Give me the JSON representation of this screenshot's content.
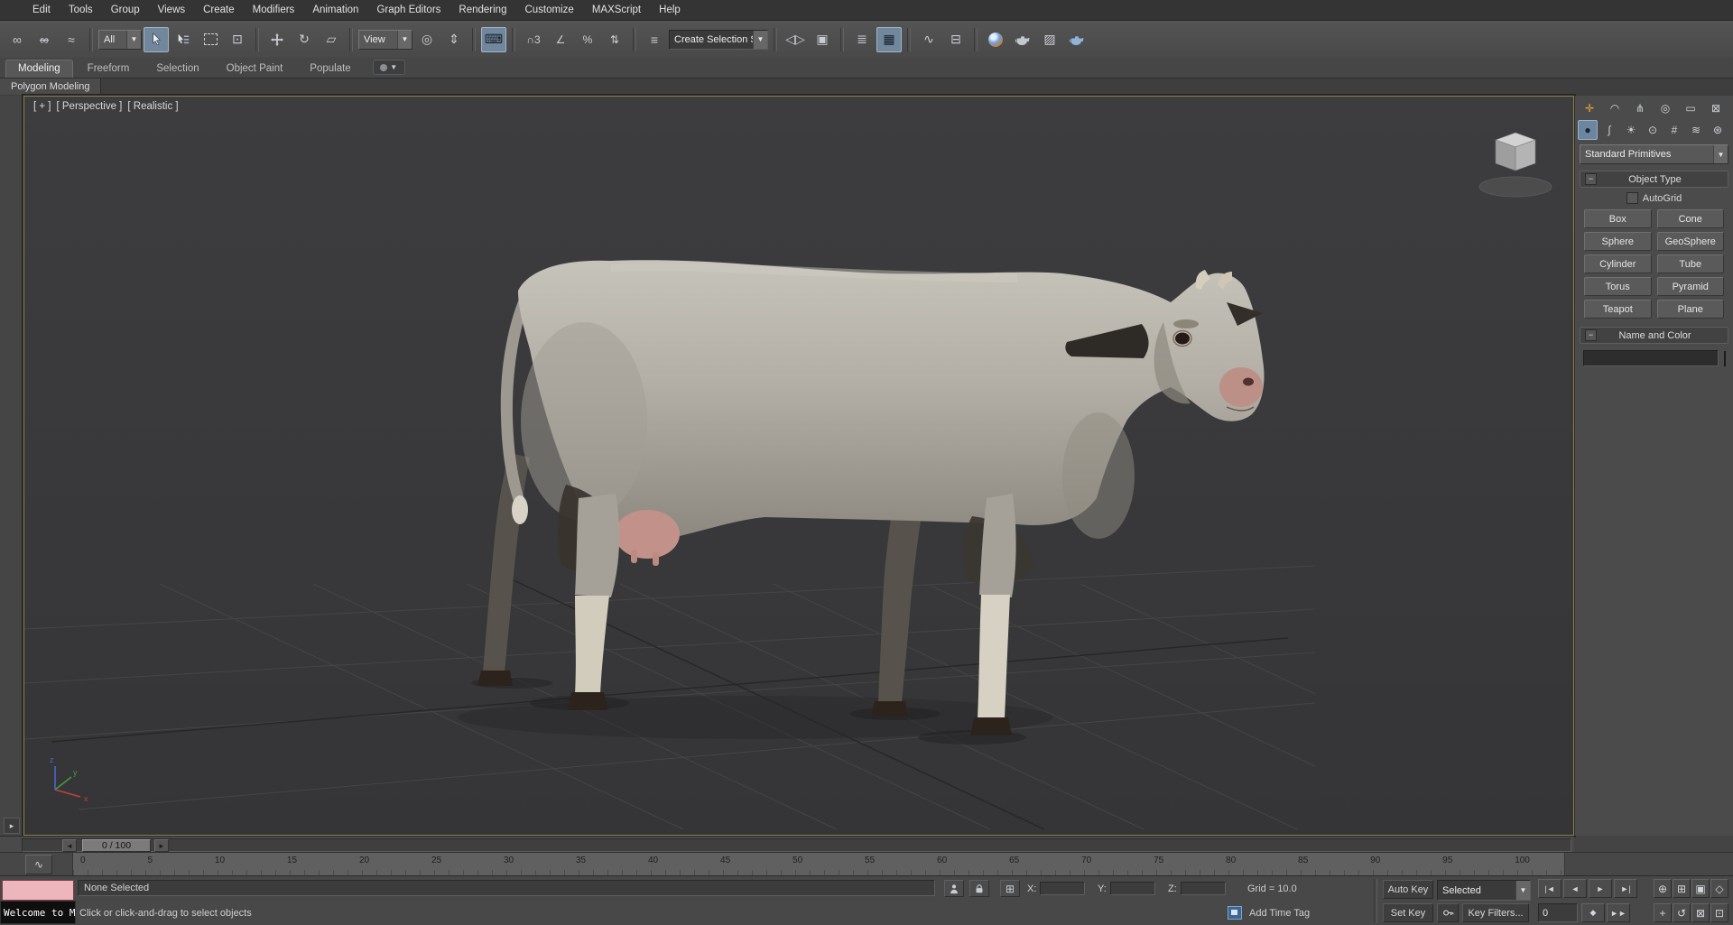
{
  "menu": {
    "items": [
      "Edit",
      "Tools",
      "Group",
      "Views",
      "Create",
      "Modifiers",
      "Animation",
      "Graph Editors",
      "Rendering",
      "Customize",
      "MAXScript",
      "Help"
    ]
  },
  "toolbar": {
    "selection_filter": "All",
    "ref_coord": "View",
    "selection_set": "Create Selection Se",
    "arrow": "▼"
  },
  "ribbon": {
    "tabs": [
      "Modeling",
      "Freeform",
      "Selection",
      "Object Paint",
      "Populate"
    ],
    "panel_tab": "Polygon Modeling"
  },
  "viewport": {
    "label_plus": "[ + ]",
    "label_view": "[ Perspective ]",
    "label_shading": "[ Realistic ]",
    "axis_x": "x",
    "axis_y": "y",
    "axis_z": "z"
  },
  "command_panel": {
    "category_dropdown": "Standard Primitives",
    "object_type": {
      "title": "Object Type",
      "autogrid_label": "AutoGrid",
      "buttons": [
        "Box",
        "Cone",
        "Sphere",
        "GeoSphere",
        "Cylinder",
        "Tube",
        "Torus",
        "Pyramid",
        "Teapot",
        "Plane"
      ]
    },
    "name_color": {
      "title": "Name and Color",
      "name_value": "",
      "swatch_color": "#e93fbe"
    }
  },
  "timeline": {
    "slider_label": "0 / 100",
    "ticks": [
      "0",
      "5",
      "10",
      "15",
      "20",
      "25",
      "30",
      "35",
      "40",
      "45",
      "50",
      "55",
      "60",
      "65",
      "70",
      "75",
      "80",
      "85",
      "90",
      "95",
      "100"
    ]
  },
  "status": {
    "selection_status": "None Selected",
    "prompt": "Click or click-and-drag to select objects",
    "listener_text": "Welcome to M",
    "x_label": "X:",
    "y_label": "Y:",
    "z_label": "Z:",
    "grid_label": "Grid = 10.0",
    "add_time_tag": "Add Time Tag",
    "auto_key": "Auto Key",
    "set_key": "Set Key",
    "selected_dropdown": "Selected",
    "key_filters": "Key Filters...",
    "frame_value": "0"
  }
}
